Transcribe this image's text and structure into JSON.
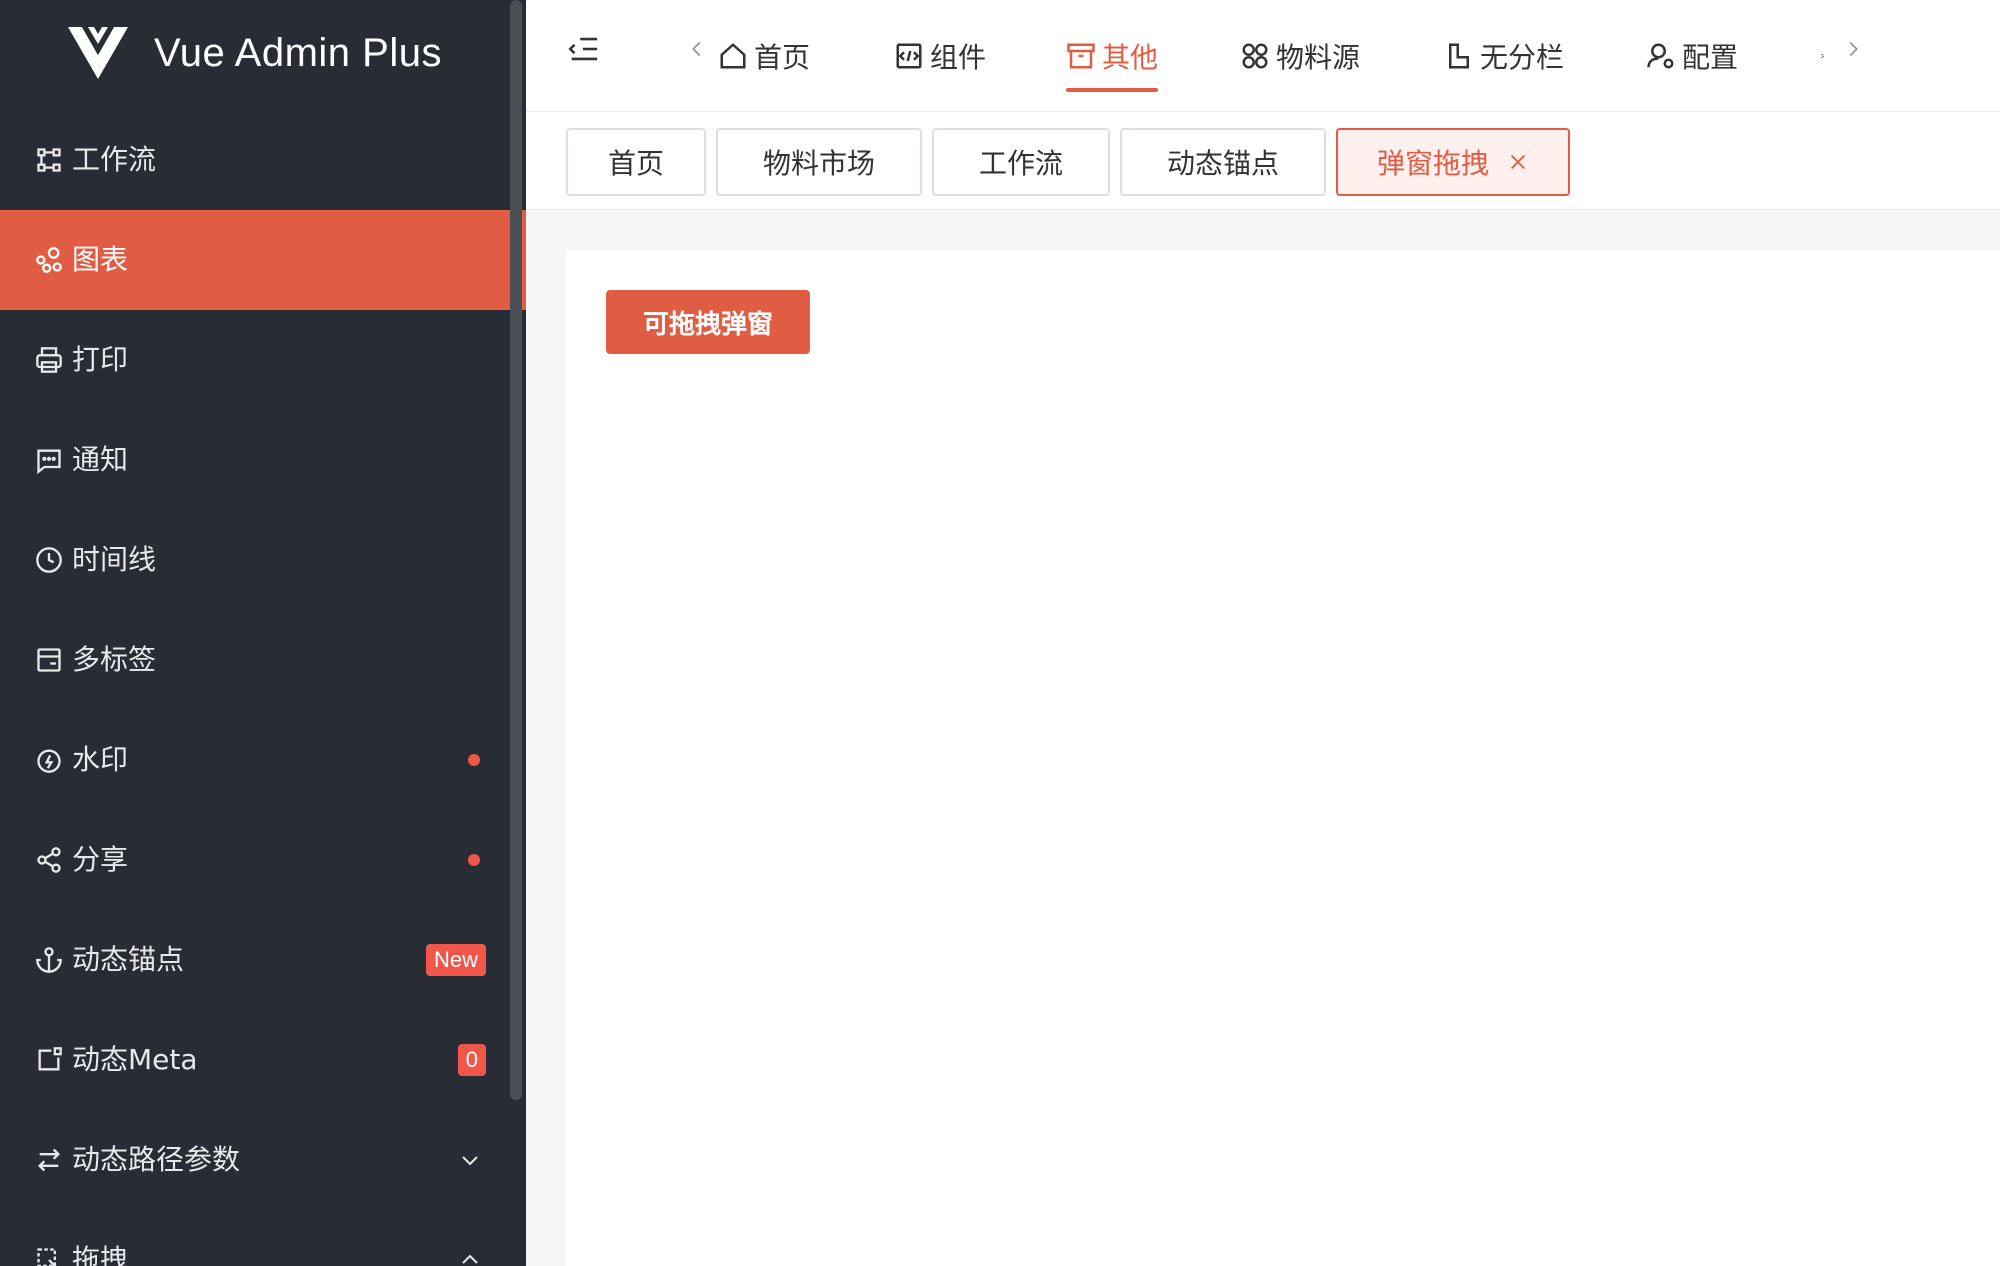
{
  "app": {
    "title": "Vue Admin Plus"
  },
  "colors": {
    "accent": "#e05d44",
    "sidebar_bg": "#282c34",
    "badge": "#f0564a"
  },
  "sidebar": {
    "items": [
      {
        "label": "工作流",
        "icon": "workflow-icon"
      },
      {
        "label": "图表",
        "icon": "chart-icon",
        "active": true
      },
      {
        "label": "打印",
        "icon": "printer-icon"
      },
      {
        "label": "通知",
        "icon": "message-icon"
      },
      {
        "label": "时间线",
        "icon": "clock-icon"
      },
      {
        "label": "多标签",
        "icon": "tabs-icon"
      },
      {
        "label": "水印",
        "icon": "drop-icon",
        "dot": true
      },
      {
        "label": "分享",
        "icon": "share-icon",
        "dot": true
      },
      {
        "label": "动态锚点",
        "icon": "anchor-icon",
        "badge": "New"
      },
      {
        "label": "动态Meta",
        "icon": "external-icon",
        "badge": "0"
      },
      {
        "label": "动态路径参数",
        "icon": "swap-icon",
        "chevron": "down"
      },
      {
        "label": "拖拽",
        "icon": "drag-icon",
        "chevron": "up"
      }
    ]
  },
  "header": {
    "menu": [
      {
        "label": "首页",
        "icon": "home-icon"
      },
      {
        "label": "组件",
        "icon": "code-icon"
      },
      {
        "label": "其他",
        "icon": "archive-icon",
        "active": true
      },
      {
        "label": "物料源",
        "icon": "grid-icon"
      },
      {
        "label": "无分栏",
        "icon": "layout-icon"
      },
      {
        "label": "配置",
        "icon": "user-settings-icon"
      }
    ]
  },
  "tabs": [
    {
      "label": "首页"
    },
    {
      "label": "物料市场"
    },
    {
      "label": "工作流"
    },
    {
      "label": "动态锚点"
    },
    {
      "label": "弹窗拖拽",
      "active": true
    }
  ],
  "main": {
    "button_label": "可拖拽弹窗"
  }
}
